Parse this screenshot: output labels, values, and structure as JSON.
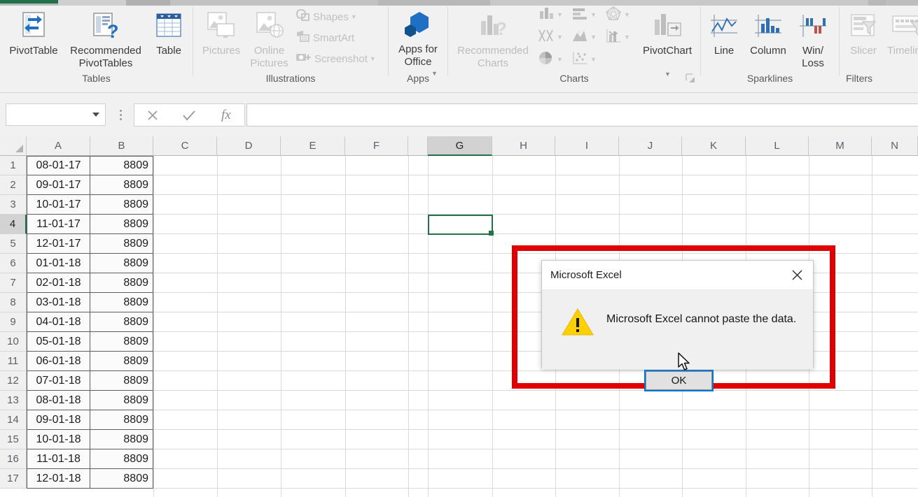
{
  "ribbon": {
    "groups": [
      {
        "name": "Tables",
        "label": "Tables"
      },
      {
        "name": "Illustrations",
        "label": "Illustrations"
      },
      {
        "name": "Apps",
        "label": "Apps"
      },
      {
        "name": "Charts",
        "label": "Charts"
      },
      {
        "name": "Sparklines",
        "label": "Sparklines"
      },
      {
        "name": "Filters",
        "label": "Filters"
      }
    ],
    "tables": {
      "pivot_table": "PivotTable",
      "recommended_pivot_tables": "Recommended\nPivotTables",
      "table": "Table"
    },
    "illustrations": {
      "pictures": "Pictures",
      "online_pictures": "Online\nPictures",
      "shapes": "Shapes",
      "smartart": "SmartArt",
      "screenshot": "Screenshot"
    },
    "apps": {
      "apps_for_office": "Apps for\nOffice"
    },
    "charts": {
      "recommended_charts": "Recommended\nCharts",
      "pivot_chart": "PivotChart",
      "types": [
        "column-chart",
        "bar-chart",
        "radar-chart",
        "line-chart",
        "area-chart",
        "combo-chart",
        "pie-chart",
        "scatter-chart"
      ]
    },
    "sparklines": {
      "line": "Line",
      "column": "Column",
      "win_loss": "Win/\nLoss"
    },
    "filters": {
      "slicer": "Slicer",
      "timeline": "Timeline"
    }
  },
  "formula_bar": {
    "name_box_value": "",
    "name_box_placeholder": "",
    "formula_value": "",
    "formula_placeholder": "",
    "cancel_icon": "cancel-x-icon",
    "enter_icon": "enter-check-icon",
    "function_icon": "fx"
  },
  "grid": {
    "columns": [
      "A",
      "B",
      "C",
      "D",
      "E",
      "F",
      "G",
      "H",
      "I",
      "J",
      "K",
      "L",
      "M",
      "N"
    ],
    "rows": [
      "1",
      "2",
      "3",
      "4",
      "5",
      "6",
      "7",
      "8",
      "9",
      "10",
      "11",
      "12",
      "13",
      "14",
      "15",
      "16",
      "17"
    ],
    "selected_cell": "G4",
    "selected_column": "G",
    "selected_row": "4",
    "data": [
      {
        "row": "1",
        "a": "08-01-17",
        "b": "8809"
      },
      {
        "row": "2",
        "a": "09-01-17",
        "b": "8809"
      },
      {
        "row": "3",
        "a": "10-01-17",
        "b": "8809"
      },
      {
        "row": "4",
        "a": "11-01-17",
        "b": "8809"
      },
      {
        "row": "5",
        "a": "12-01-17",
        "b": "8809"
      },
      {
        "row": "6",
        "a": "01-01-18",
        "b": "8809"
      },
      {
        "row": "7",
        "a": "02-01-18",
        "b": "8809"
      },
      {
        "row": "8",
        "a": "03-01-18",
        "b": "8809"
      },
      {
        "row": "9",
        "a": "04-01-18",
        "b": "8809"
      },
      {
        "row": "10",
        "a": "05-01-18",
        "b": "8809"
      },
      {
        "row": "11",
        "a": "06-01-18",
        "b": "8809"
      },
      {
        "row": "12",
        "a": "07-01-18",
        "b": "8809"
      },
      {
        "row": "13",
        "a": "08-01-18",
        "b": "8809"
      },
      {
        "row": "14",
        "a": "09-01-18",
        "b": "8809"
      },
      {
        "row": "15",
        "a": "10-01-18",
        "b": "8809"
      },
      {
        "row": "16",
        "a": "11-01-18",
        "b": "8809"
      },
      {
        "row": "17",
        "a": "12-01-18",
        "b": "8809"
      }
    ]
  },
  "dialog": {
    "title": "Microsoft Excel",
    "message": "Microsoft Excel cannot paste the data.",
    "ok_label": "OK",
    "close_icon": "close-x-icon",
    "warning_icon": "warning-triangle-icon",
    "highlight_color": "#e00000",
    "focus_color": "#0078d7"
  },
  "colors": {
    "excel_green": "#217346",
    "warning_yellow": "#ffd000",
    "accent_blue": "#1f6fc4"
  }
}
